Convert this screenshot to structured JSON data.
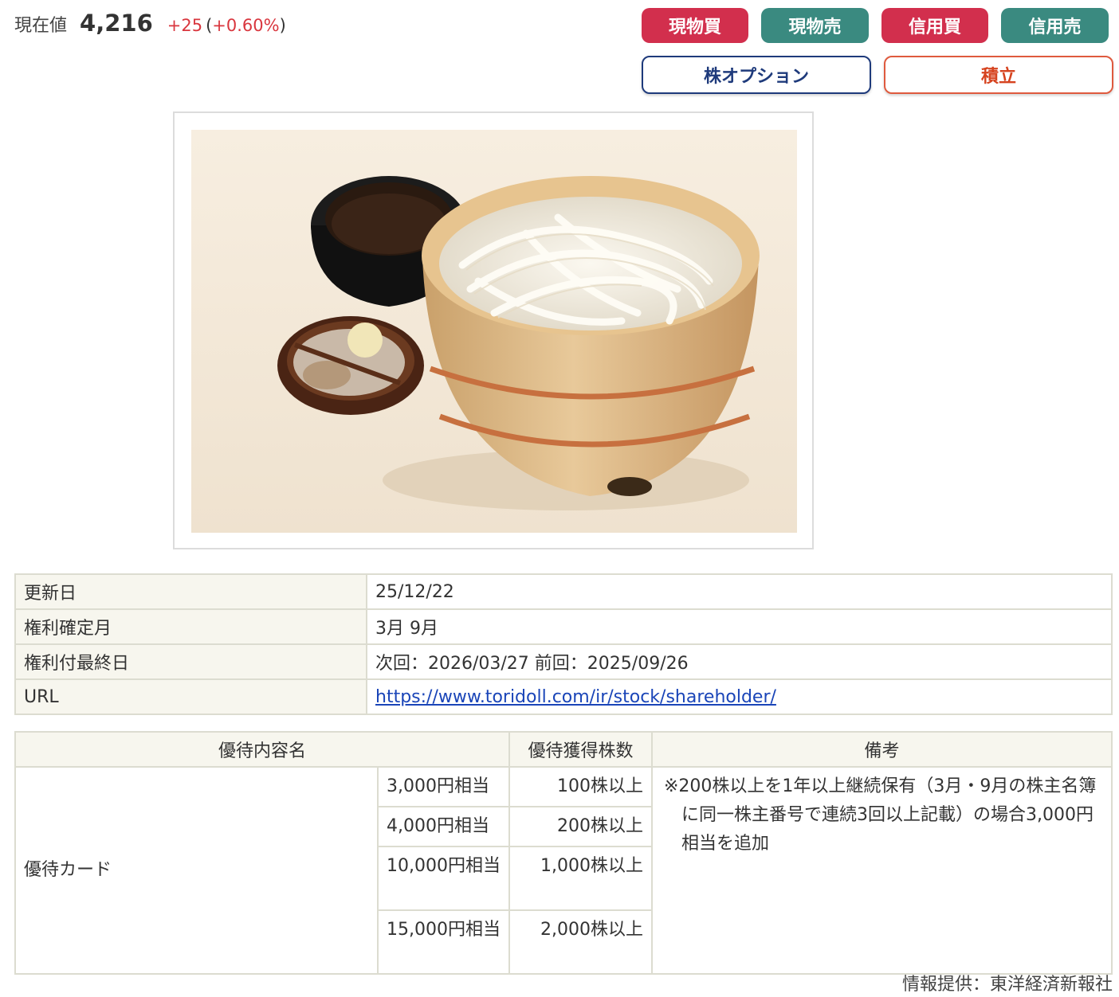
{
  "quote": {
    "label": "現在値",
    "price": "4,216",
    "change": "+25",
    "paren_open": "(",
    "change_pct": "+0.60%",
    "paren_close": ")"
  },
  "buttons": {
    "spot_buy": "現物買",
    "spot_sell": "現物売",
    "margin_buy": "信用買",
    "margin_sell": "信用売",
    "stock_option": "株オプション",
    "accumulate": "積立"
  },
  "info_rows": [
    {
      "key": "更新日",
      "value": "25/12/22"
    },
    {
      "key": "権利確定月",
      "value": "3月 9月"
    },
    {
      "key": "権利付最終日",
      "value": "次回：2026/03/27 前回：2025/09/26"
    },
    {
      "key": "URL",
      "value": "https://www.toridoll.com/ir/stock/shareholder/"
    }
  ],
  "perk_table": {
    "headers": [
      "優待内容名",
      "優待獲得株数",
      "備考"
    ],
    "name": "優待カード",
    "rows": [
      {
        "amount": "3,000円相当",
        "shares": "100株以上"
      },
      {
        "amount": "4,000円相当",
        "shares": "200株以上"
      },
      {
        "amount": "10,000円相当",
        "shares": "1,000株以上"
      },
      {
        "amount": "15,000円相当",
        "shares": "2,000株以上"
      }
    ],
    "note": "※200株以上を1年以上継続保有（3月・9月の株主名簿に同一株主番号で連続3回以上記載）の場合3,000円相当を追加"
  },
  "footer": "情報提供：東洋経済新報社",
  "colors": {
    "buy": "#d22f4d",
    "sell": "#3a8a80",
    "up": "#d9363e",
    "navy": "#1e3a7b",
    "orange": "#df5a3e"
  }
}
